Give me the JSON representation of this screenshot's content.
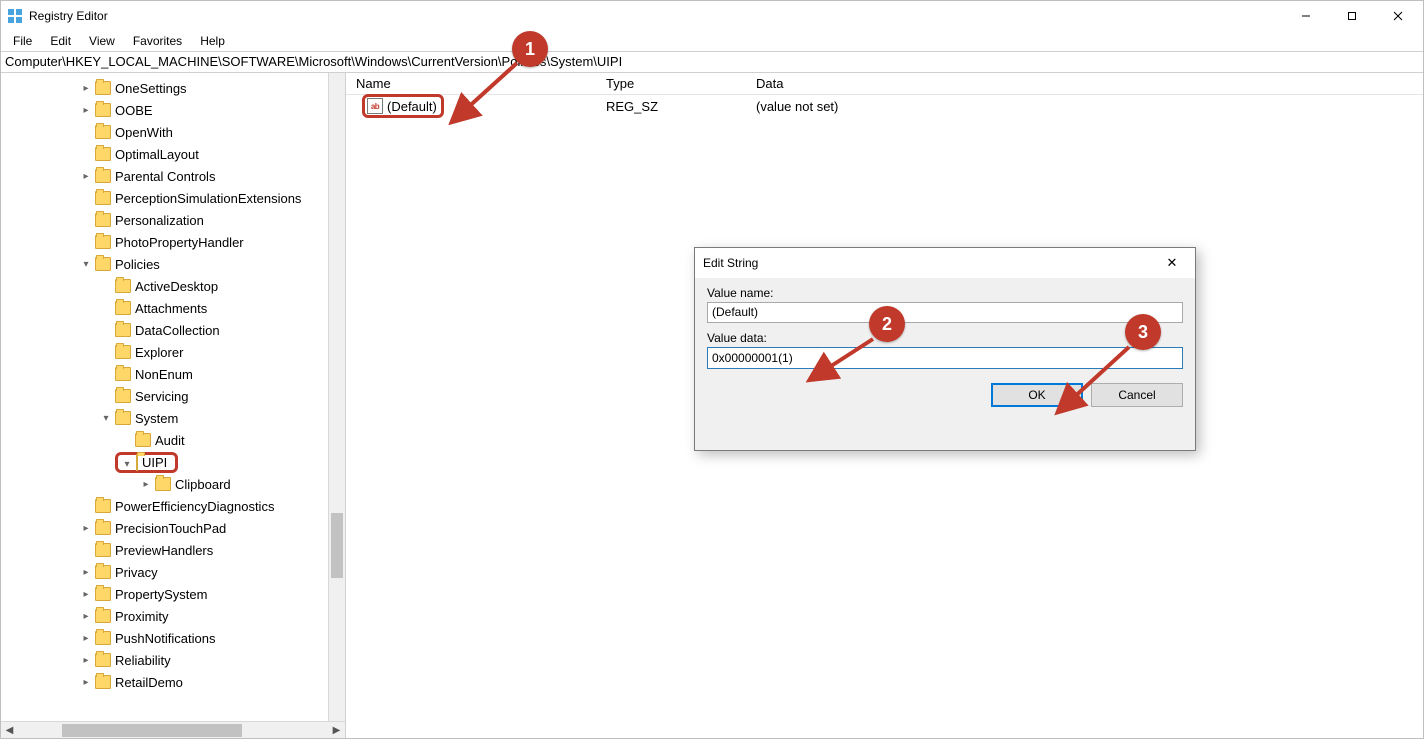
{
  "window": {
    "title": "Registry Editor"
  },
  "menu": {
    "file": "File",
    "edit": "Edit",
    "view": "View",
    "favorites": "Favorites",
    "help": "Help"
  },
  "address": "Computer\\HKEY_LOCAL_MACHINE\\SOFTWARE\\Microsoft\\Windows\\CurrentVersion\\Policies\\System\\UIPI",
  "tree": {
    "items": [
      {
        "indent": 78,
        "expander": ">",
        "label": "OneSettings"
      },
      {
        "indent": 78,
        "expander": ">",
        "label": "OOBE"
      },
      {
        "indent": 78,
        "expander": "",
        "label": "OpenWith"
      },
      {
        "indent": 78,
        "expander": "",
        "label": "OptimalLayout"
      },
      {
        "indent": 78,
        "expander": ">",
        "label": "Parental Controls"
      },
      {
        "indent": 78,
        "expander": "",
        "label": "PerceptionSimulationExtensions"
      },
      {
        "indent": 78,
        "expander": "",
        "label": "Personalization"
      },
      {
        "indent": 78,
        "expander": "",
        "label": "PhotoPropertyHandler"
      },
      {
        "indent": 78,
        "expander": "v",
        "label": "Policies"
      },
      {
        "indent": 98,
        "expander": "",
        "label": "ActiveDesktop"
      },
      {
        "indent": 98,
        "expander": "",
        "label": "Attachments"
      },
      {
        "indent": 98,
        "expander": "",
        "label": "DataCollection"
      },
      {
        "indent": 98,
        "expander": "",
        "label": "Explorer"
      },
      {
        "indent": 98,
        "expander": "",
        "label": "NonEnum"
      },
      {
        "indent": 98,
        "expander": "",
        "label": "Servicing"
      },
      {
        "indent": 98,
        "expander": "v",
        "label": "System"
      },
      {
        "indent": 118,
        "expander": "",
        "label": "Audit"
      },
      {
        "indent": 118,
        "expander": "v",
        "label": "UIPI",
        "highlight": true
      },
      {
        "indent": 138,
        "expander": ">",
        "label": "Clipboard"
      },
      {
        "indent": 78,
        "expander": "",
        "label": "PowerEfficiencyDiagnostics"
      },
      {
        "indent": 78,
        "expander": ">",
        "label": "PrecisionTouchPad"
      },
      {
        "indent": 78,
        "expander": "",
        "label": "PreviewHandlers"
      },
      {
        "indent": 78,
        "expander": ">",
        "label": "Privacy"
      },
      {
        "indent": 78,
        "expander": ">",
        "label": "PropertySystem"
      },
      {
        "indent": 78,
        "expander": ">",
        "label": "Proximity"
      },
      {
        "indent": 78,
        "expander": ">",
        "label": "PushNotifications"
      },
      {
        "indent": 78,
        "expander": ">",
        "label": "Reliability"
      },
      {
        "indent": 78,
        "expander": ">",
        "label": "RetailDemo"
      }
    ]
  },
  "list": {
    "headers": {
      "name": "Name",
      "type": "Type",
      "data": "Data"
    },
    "rows": [
      {
        "name": "(Default)",
        "type": "REG_SZ",
        "data": "(value not set)",
        "highlight": true
      }
    ]
  },
  "dialog": {
    "title": "Edit String",
    "value_name_label": "Value name:",
    "value_name": "(Default)",
    "value_data_label": "Value data:",
    "value_data": "0x00000001(1)",
    "ok": "OK",
    "cancel": "Cancel"
  },
  "callouts": {
    "c1": "1",
    "c2": "2",
    "c3": "3"
  }
}
